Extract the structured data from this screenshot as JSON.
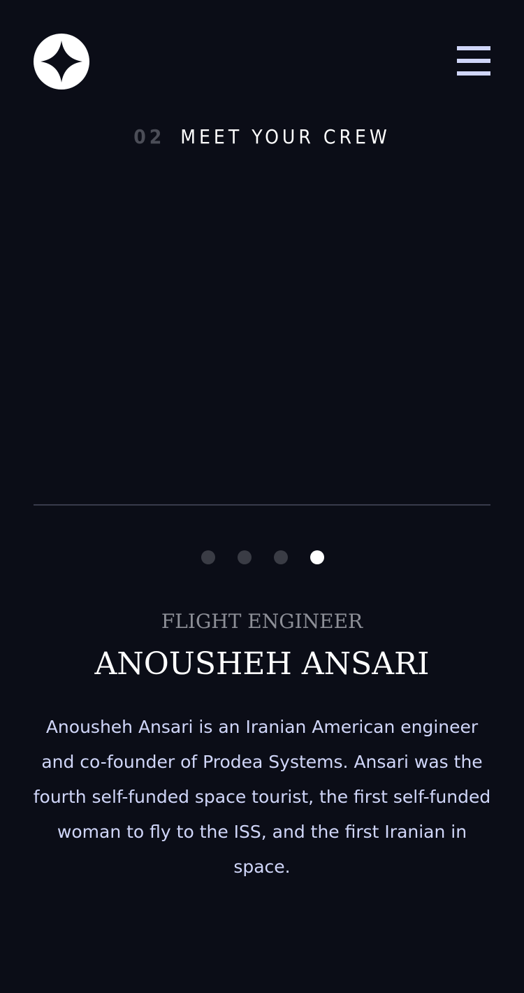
{
  "header": {
    "logo_icon": "star-logo-icon",
    "menu_icon": "hamburger-menu-icon"
  },
  "page": {
    "number": "02",
    "title": "MEET YOUR CREW"
  },
  "slider": {
    "total": 4,
    "active_index": 3
  },
  "crew": {
    "role": "Flight Engineer",
    "name": "Anousheh Ansari",
    "bio": "Anousheh Ansari is an Iranian American engineer and co-founder of Prodea Systems. Ansari was the fourth self-funded space tourist, the first self-funded woman to fly to the ISS, and the first Iranian in space."
  },
  "colors": {
    "background": "#0b0d17",
    "accent_text": "#d0d6f9",
    "active_dot": "#ffffff",
    "inactive_dot": "#3a3c45"
  }
}
